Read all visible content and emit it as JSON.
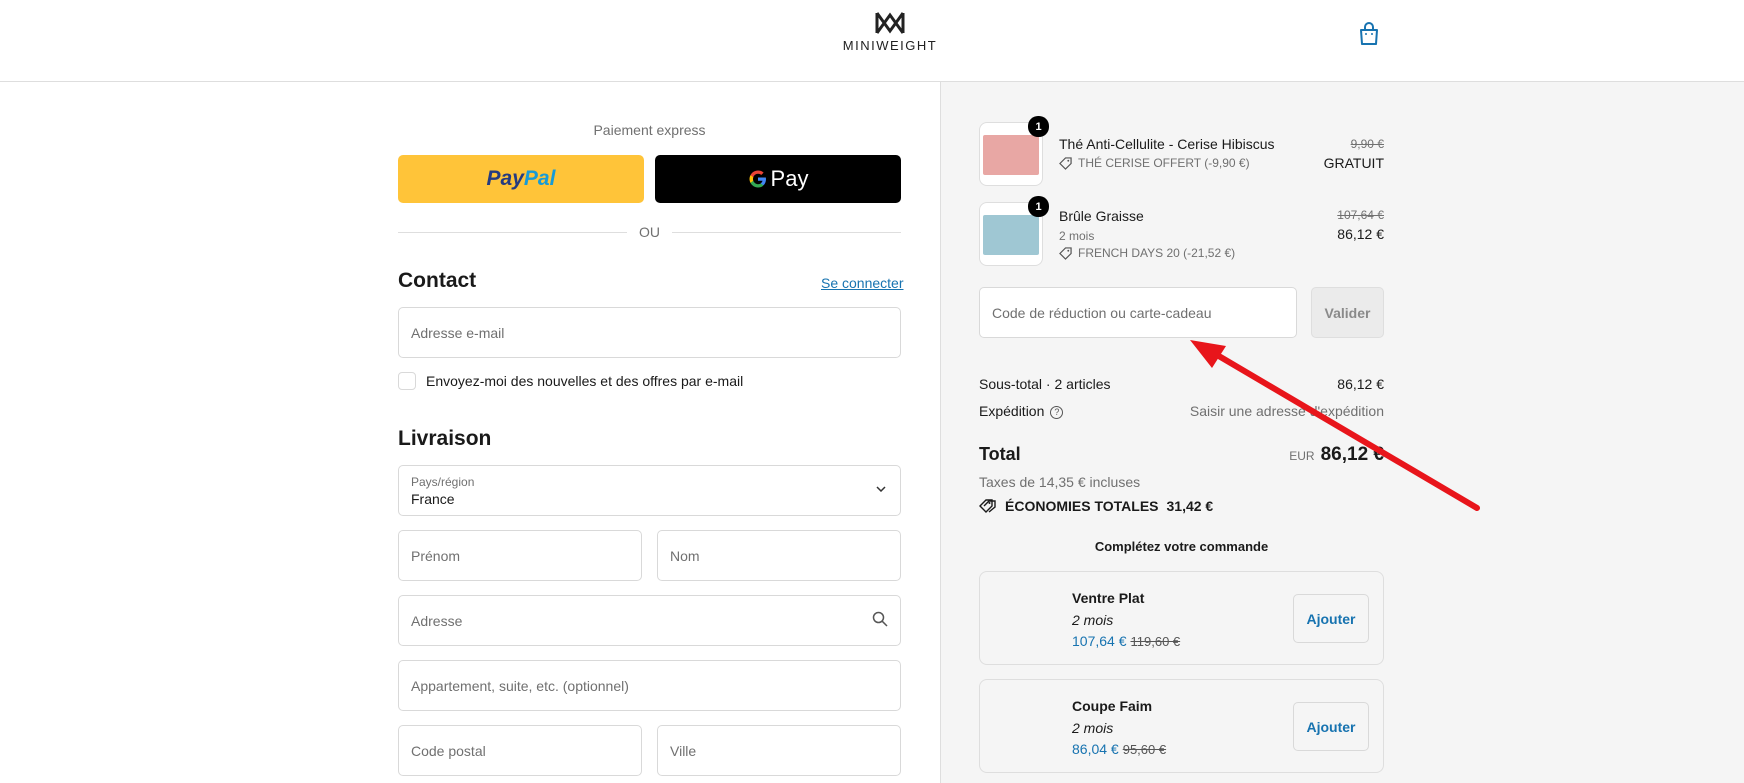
{
  "header": {
    "brand": "MINIWEIGHT",
    "cart_icon": "shopping-bag-icon"
  },
  "express": {
    "title": "Paiement express",
    "paypal_a": "Pay",
    "paypal_b": "Pal",
    "gpay_label": "Pay",
    "separator": "OU"
  },
  "contact": {
    "title": "Contact",
    "login_link": "Se connecter",
    "email_placeholder": "Adresse e-mail",
    "newsletter_label": "Envoyez-moi des nouvelles et des offres par e-mail"
  },
  "delivery": {
    "title": "Livraison",
    "country_label": "Pays/région",
    "country_value": "France",
    "first_name": "Prénom",
    "last_name": "Nom",
    "address": "Adresse",
    "apartment": "Appartement, suite, etc. (optionnel)",
    "postal_code": "Code postal",
    "city": "Ville"
  },
  "cart": {
    "items": [
      {
        "quantity": "1",
        "name": "Thé Anti-Cellulite - Cerise Hibiscus",
        "discount": "THÉ CERISE OFFERT (-9,90 €)",
        "old_price": "9,90 €",
        "price": "GRATUIT",
        "color": "#e8a7a4"
      },
      {
        "quantity": "1",
        "name": "Brûle Graisse",
        "variant": "2 mois",
        "discount": "FRENCH DAYS 20 (-21,52 €)",
        "old_price": "107,64 €",
        "price": "86,12 €",
        "color": "#9fc7d3"
      }
    ],
    "code_placeholder": "Code de réduction ou carte-cadeau",
    "apply_label": "Valider",
    "subtotal_label": "Sous-total · 2 articles",
    "subtotal_value": "86,12 €",
    "shipping_label": "Expédition",
    "shipping_value": "Saisir une adresse d'expédition",
    "total_label": "Total",
    "total_currency": "EUR",
    "total_value": "86,12 €",
    "taxes": "Taxes de 14,35 € incluses",
    "savings_label": "ÉCONOMIES TOTALES",
    "savings_value": "31,42 €",
    "upsell_title": "Complétez votre commande",
    "upsells": [
      {
        "name": "Ventre Plat",
        "duration": "2 mois",
        "price": "107,64 €",
        "old_price": "119,60 €",
        "add_label": "Ajouter"
      },
      {
        "name": "Coupe Faim",
        "duration": "2 mois",
        "price": "86,04 €",
        "old_price": "95,60 €",
        "add_label": "Ajouter"
      }
    ]
  },
  "annotation": {
    "arrow_color": "#e8151b"
  }
}
